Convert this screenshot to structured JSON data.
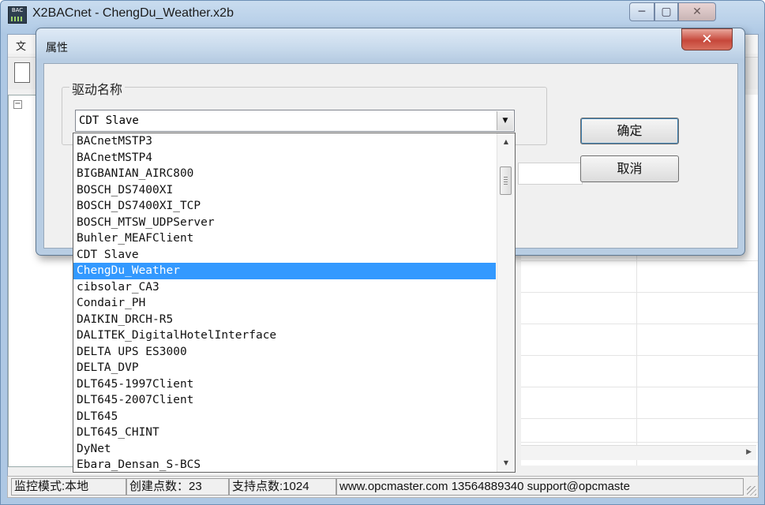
{
  "main_window": {
    "title": "X2BACnet - ChengDu_Weather.x2b",
    "icon_label": "BAC",
    "menu_first": "文",
    "minimize_glyph": "─",
    "maximize_glyph": "▢",
    "close_glyph": "✕"
  },
  "dialog": {
    "title": "属性",
    "close_glyph": "✕",
    "group_label": "驱动名称",
    "combo_value": "CDT Slave",
    "ok_label": "确定",
    "cancel_label": "取消"
  },
  "dropdown": {
    "items": [
      "BACnetMSTP3",
      "BACnetMSTP4",
      "BIGBANIAN_AIRC800",
      "BOSCH_DS7400XI",
      "BOSCH_DS7400XI_TCP",
      "BOSCH_MTSW_UDPServer",
      "Buhler_MEAFClient",
      "CDT Slave",
      "ChengDu_Weather",
      "cibsolar_CA3",
      "Condair_PH",
      "DAIKIN_DRCH-R5",
      "DALITEK_DigitalHotelInterface",
      "DELTA UPS ES3000",
      "DELTA_DVP",
      "DLT645-1997Client",
      "DLT645-2007Client",
      "DLT645",
      "DLT645_CHINT",
      "DyNet",
      "Ebara_Densan_S-BCS"
    ],
    "selected_index": 8
  },
  "statusbar": {
    "mode": "监控模式:本地",
    "created_points": "创建点数：23",
    "supported_points": "支持点数:1024",
    "contact": "www.opcmaster.com 13564889340 support@opcmaste"
  },
  "colors": {
    "selection": "#3399ff",
    "titlebar": "#b9d1ea",
    "close_button": "#c6473a"
  }
}
